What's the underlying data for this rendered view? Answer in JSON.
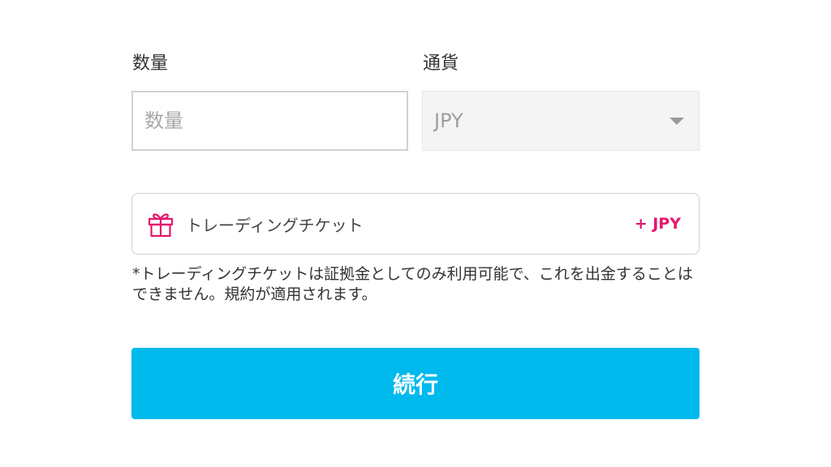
{
  "form": {
    "quantity": {
      "label": "数量",
      "placeholder": "数量",
      "value": ""
    },
    "currency": {
      "label": "通貨",
      "selected": "JPY",
      "icon": "chevron-down-icon"
    },
    "ticket": {
      "icon": "gift-icon",
      "label": "トレーディングチケット",
      "amount": "+ JPY",
      "amount_color": "#e6176e"
    },
    "note": "*トレーディングチケットは証拠金としてのみ利用可能で、これを出金することはできません。規約が適用されます。",
    "continue_label": "続行",
    "accent_color": "#00b9ed"
  }
}
